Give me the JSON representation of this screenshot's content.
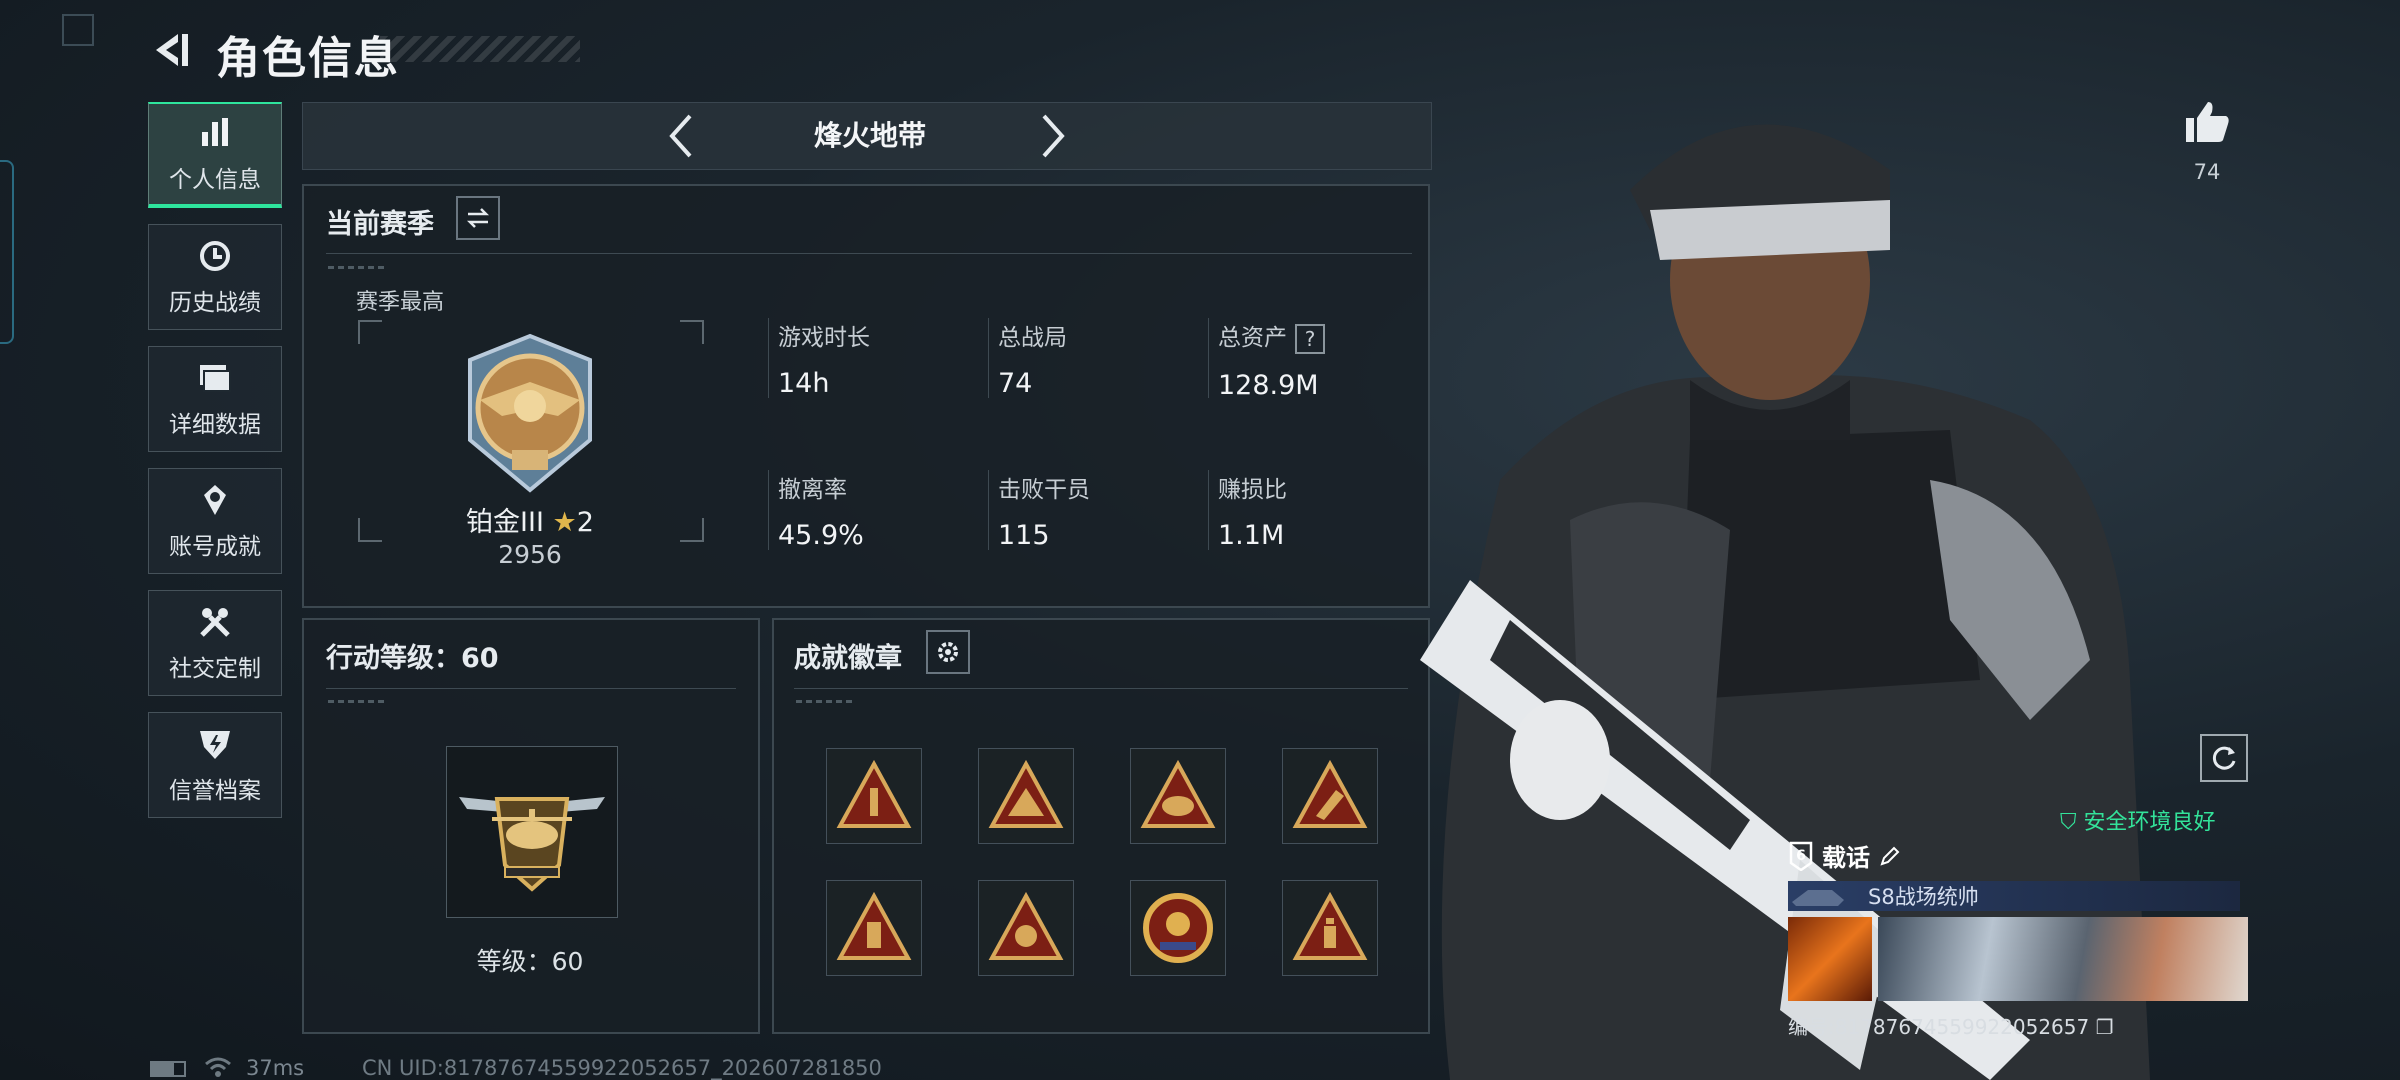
{
  "header": {
    "title": "角色信息"
  },
  "sidebar": {
    "items": [
      {
        "label": "个人信息",
        "icon": "bar-chart-icon",
        "active": true
      },
      {
        "label": "历史战绩",
        "icon": "history-icon"
      },
      {
        "label": "详细数据",
        "icon": "folder-icon"
      },
      {
        "label": "账号成就",
        "icon": "achievement-icon"
      },
      {
        "label": "社交定制",
        "icon": "tools-icon"
      },
      {
        "label": "信誉档案",
        "icon": "shield-bolt-icon"
      }
    ]
  },
  "mode": {
    "name": "烽火地带"
  },
  "season": {
    "title": "当前赛季",
    "best_label": "赛季最高",
    "rank_name": "铂金III",
    "rank_stars": "2",
    "rank_score": "2956",
    "stats": [
      {
        "label": "游戏时长",
        "value": "14h"
      },
      {
        "label": "总战局",
        "value": "74"
      },
      {
        "label": "总资产",
        "value": "128.9M",
        "help": "?"
      },
      {
        "label": "撤离率",
        "value": "45.9%"
      },
      {
        "label": "击败干员",
        "value": "115"
      },
      {
        "label": "赚损比",
        "value": "1.1M"
      }
    ]
  },
  "action_level": {
    "title": "行动等级：60",
    "level_label": "等级：60"
  },
  "achievements": {
    "title": "成就徽章"
  },
  "footer": {
    "ping": "37ms",
    "uid": "CN UID:8178767455992205265​7_202607281850"
  },
  "profile": {
    "likes": "74",
    "safety": "安全环境良好",
    "card_title": "载话",
    "card_subtitle": "S8战场统帅",
    "card_id": "编号:8178767455992205265​7"
  },
  "colors": {
    "accent": "#2ee59d",
    "gold": "#c9a45a",
    "panel": "#18202a"
  }
}
